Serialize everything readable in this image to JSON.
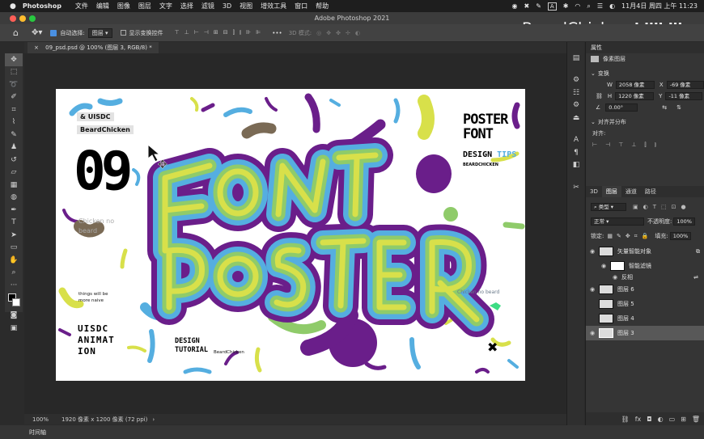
{
  "menubar": {
    "app": "Photoshop",
    "items": [
      "文件",
      "编辑",
      "图像",
      "图层",
      "文字",
      "选择",
      "滤镜",
      "3D",
      "视图",
      "增效工具",
      "窗口",
      "帮助"
    ],
    "clock": "11月4日 周四 上午 11:23",
    "input_indicator": "A"
  },
  "window": {
    "title": "Adobe Photoshop 2021"
  },
  "watermark": {
    "name": "BeardChicken",
    "brand": "bilibili"
  },
  "options": {
    "auto_select_label": "自动选择:",
    "auto_select_value": "图层",
    "show_transform_label": "显示变换控件",
    "mode_3d": "3D 模式:",
    "more": "•••"
  },
  "document": {
    "tab": "09_psd.psd @ 100% (图层 3, RGB/8) *",
    "close": "×"
  },
  "status": {
    "zoom": "100%",
    "info": "1920 像素 x 1200 像素 (72 ppi)",
    "arrow": "›"
  },
  "timeline": {
    "label": "时间轴"
  },
  "poster": {
    "tag1": "& UISDC",
    "tag2": "BeardChicken",
    "number": "09",
    "chicken_note": "Chicken no beard",
    "title1": "POSTER",
    "title2": "FONT",
    "design_tips_prefix": "DESIGN ",
    "design_tips_accent": "TIPS",
    "design_tips_by": "BEARDCHICKEN",
    "naive_line1": "things will be",
    "naive_line2": "more naive",
    "animation": "UISDC\nANIMAT\nION",
    "tutorial": "DESIGN\nTUTORIAL",
    "tutorial_by": "BeardChicken",
    "inner_note": "Chicken no beard",
    "x_mark": "✖",
    "colors": {
      "purple": "#6a1e8a",
      "blue": "#55aee0",
      "green": "#8fcb6a",
      "yellow": "#d8e04a",
      "brown": "#7a6a55"
    }
  },
  "properties": {
    "header": "属性",
    "pixel_layer": "像素图层",
    "transform": "变换",
    "w_label": "W",
    "w_value": "2058 像素",
    "x_label": "X",
    "x_value": "-69 像素",
    "h_label": "H",
    "h_value": "1220 像素",
    "y_label": "Y",
    "y_value": "-11 像素",
    "angle": "0.00°",
    "align": "对齐并分布",
    "align_label": "对齐:"
  },
  "layers_panel": {
    "tabs": [
      "3D",
      "图层",
      "通道",
      "路径"
    ],
    "kind": "类型",
    "blend": "正常",
    "opacity_label": "不透明度:",
    "opacity": "100%",
    "lock_label": "锁定:",
    "fill_label": "填充:",
    "fill": "100%",
    "layers": [
      {
        "name": "矢量智能对象",
        "visible": true
      },
      {
        "name": "智能滤镜",
        "visible": true
      },
      {
        "name": "反相",
        "visible": true
      },
      {
        "name": "图层 6",
        "visible": true
      },
      {
        "name": "图层 5",
        "visible": false
      },
      {
        "name": "图层 4",
        "visible": false
      },
      {
        "name": "图层 3",
        "visible": true,
        "selected": true
      }
    ],
    "footer_icons": [
      "link-icon",
      "fx-icon",
      "mask-icon",
      "adjustment-icon",
      "folder-icon",
      "new-layer-icon",
      "trash-icon"
    ]
  }
}
